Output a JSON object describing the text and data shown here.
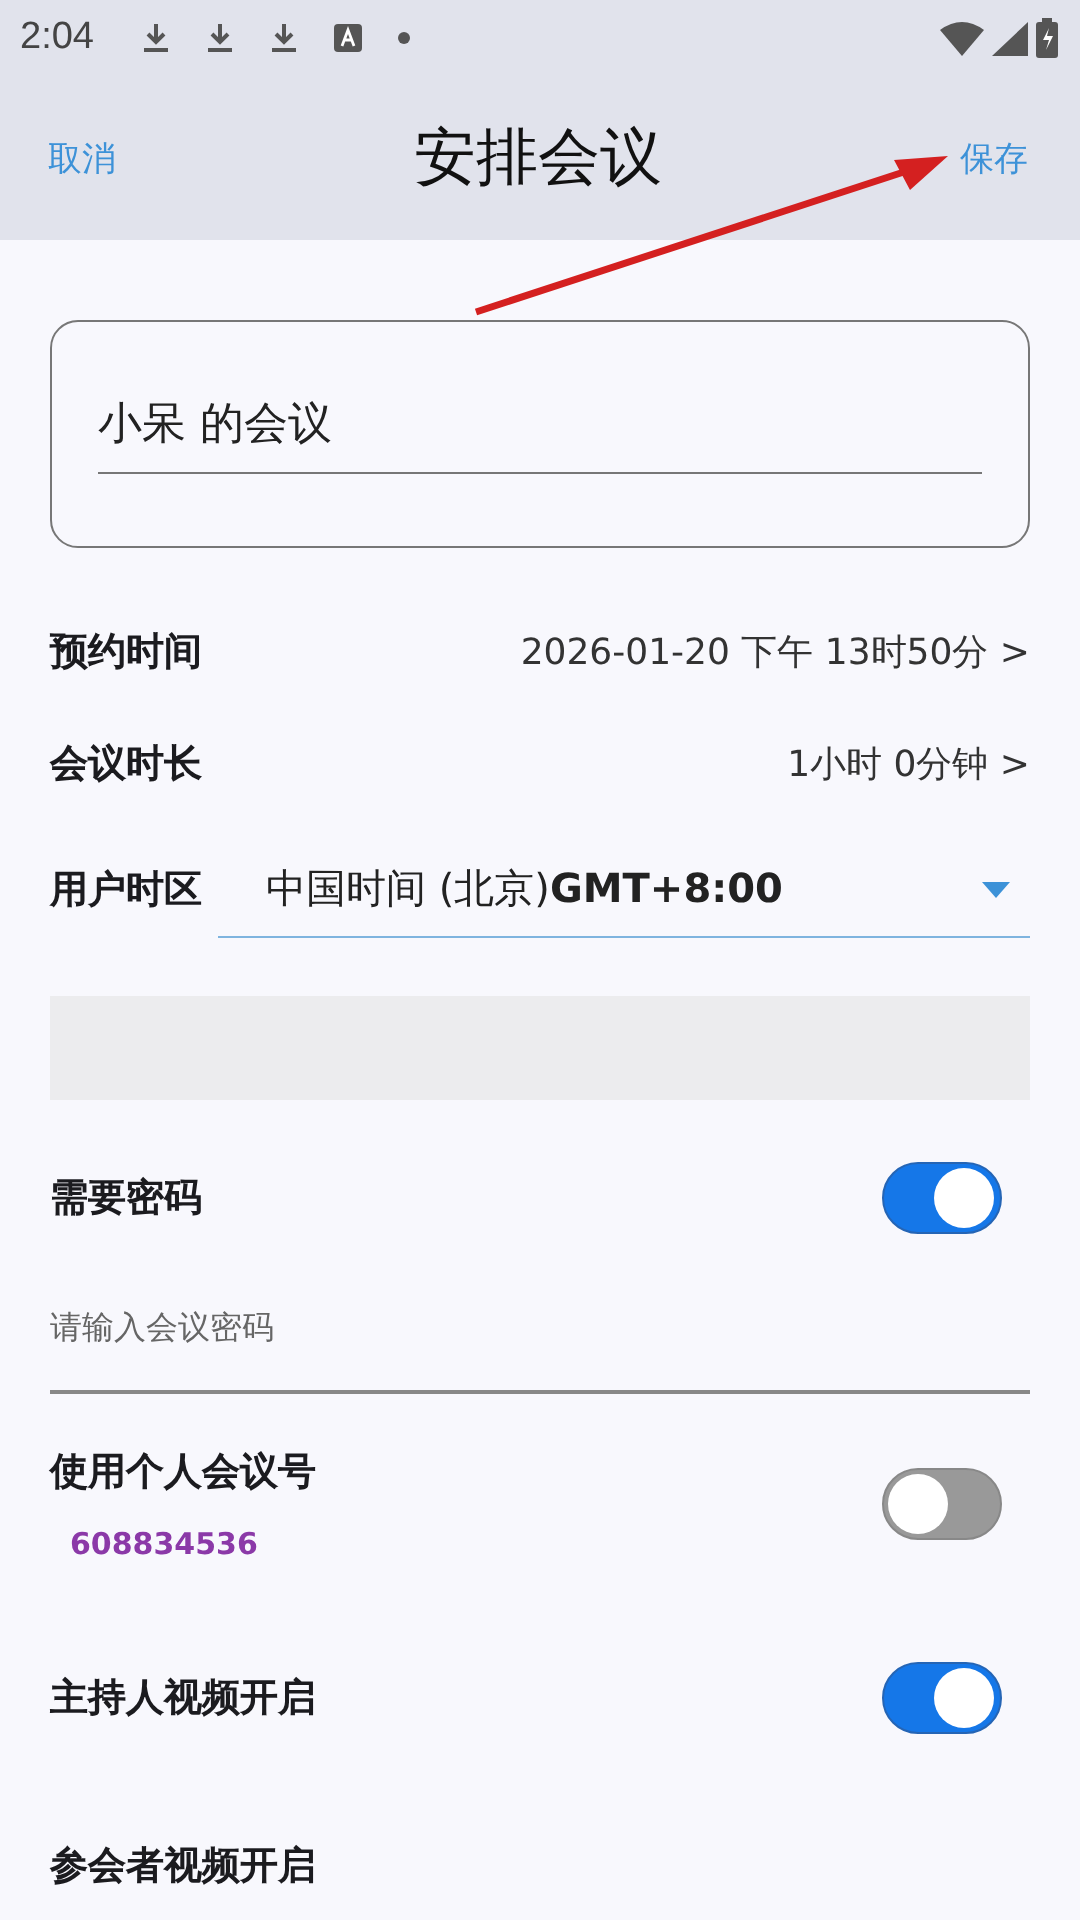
{
  "status_bar": {
    "time": "2:04"
  },
  "header": {
    "cancel": "取消",
    "title": "安排会议",
    "save": "保存"
  },
  "topic": {
    "value": "小呆 的会议"
  },
  "settings": [
    {
      "label": "预约时间",
      "value": "2026-01-20 下午 13时50分 >"
    },
    {
      "label": "会议时长",
      "value": "1小时 0分钟 >"
    }
  ],
  "timezone": {
    "label": "用户时区",
    "value": "中国时间 (北京)**GMT+8:00**"
  },
  "password": {
    "label": "需要密码",
    "on": true,
    "placeholder": "请输入会议密码"
  },
  "options": [
    {
      "kind": "toggle",
      "label": "使用个人会议号",
      "note": "608834536",
      "on": false
    },
    {
      "kind": "toggle",
      "label": "主持人视频开启",
      "on": true
    },
    {
      "kind": "plain",
      "label": "参会者视频开启"
    }
  ],
  "annotation": {
    "kind": "arrow"
  }
}
